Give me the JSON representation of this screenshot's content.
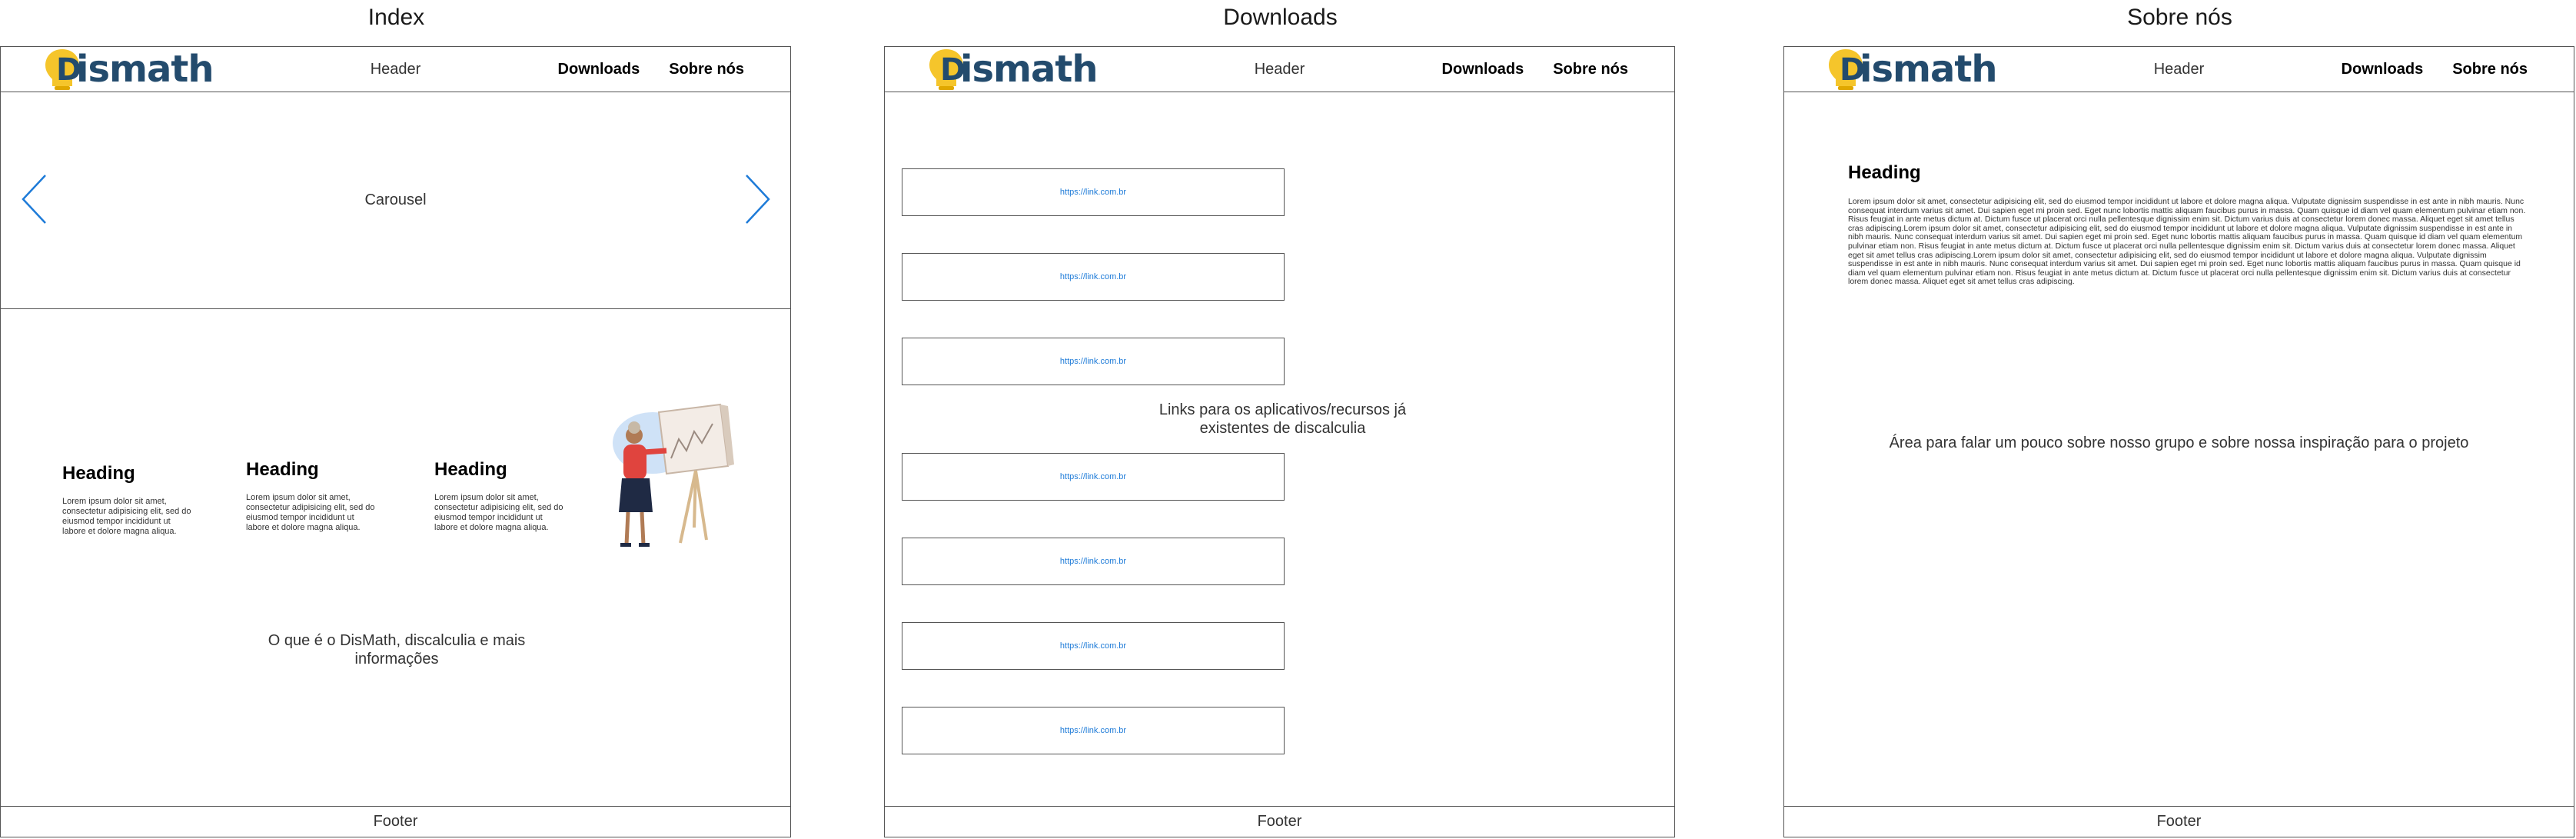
{
  "pages": {
    "index": {
      "title": "Index",
      "carousel_label": "Carousel",
      "features": [
        {
          "heading": "Heading",
          "text": "Lorem ipsum dolor sit amet, consectetur adipisicing elit, sed do eiusmod tempor incididunt ut labore et dolore magna aliqua."
        },
        {
          "heading": "Heading",
          "text": "Lorem ipsum dolor sit amet, consectetur adipisicing elit, sed do eiusmod tempor incididunt ut labore et dolore magna aliqua."
        },
        {
          "heading": "Heading",
          "text": "Lorem ipsum dolor sit amet, consectetur adipisicing elit, sed do eiusmod tempor incididunt ut labore et dolore magna aliqua."
        }
      ],
      "note": "O que é o DisMath, discalculia e mais informações"
    },
    "downloads": {
      "title": "Downloads",
      "links": [
        "https://link.com.br",
        "https://link.com.br",
        "https://link.com.br",
        "https://link.com.br",
        "https://link.com.br",
        "https://link.com.br",
        "https://link.com.br"
      ],
      "note": "Links para os aplicativos/recursos já existentes de discalculia"
    },
    "sobre": {
      "title": "Sobre nós",
      "heading": "Heading",
      "text": "Lorem ipsum dolor sit amet, consectetur adipisicing elit, sed do eiusmod tempor incididunt ut labore et dolore magna aliqua. Vulputate dignissim suspendisse in est ante in nibh mauris. Nunc consequat interdum varius sit amet. Dui sapien eget mi proin sed. Eget nunc lobortis mattis aliquam faucibus purus in massa. Quam quisque id diam vel quam elementum pulvinar etiam non. Risus feugiat in ante metus dictum at. Dictum fusce ut placerat orci nulla pellentesque dignissim enim sit. Dictum varius duis at consectetur lorem donec massa. Aliquet eget sit amet tellus cras adipiscing.Lorem ipsum dolor sit amet, consectetur adipisicing elit, sed do eiusmod tempor incididunt ut labore et dolore magna aliqua. Vulputate dignissim suspendisse in est ante in nibh mauris. Nunc consequat interdum varius sit amet. Dui sapien eget mi proin sed. Eget nunc lobortis mattis aliquam faucibus purus in massa. Quam quisque id diam vel quam elementum pulvinar etiam non. Risus feugiat in ante metus dictum at. Dictum fusce ut placerat orci nulla pellentesque dignissim enim sit. Dictum varius duis at consectetur lorem donec massa. Aliquet eget sit amet tellus cras adipiscing.Lorem ipsum dolor sit amet, consectetur adipisicing elit, sed do eiusmod tempor incididunt ut labore et dolore magna aliqua. Vulputate dignissim suspendisse in est ante in nibh mauris. Nunc consequat interdum varius sit amet. Dui sapien eget mi proin sed. Eget nunc lobortis mattis aliquam faucibus purus in massa. Quam quisque id diam vel quam elementum pulvinar etiam non. Risus feugiat in ante metus dictum at. Dictum fusce ut placerat orci nulla pellentesque dignissim enim sit. Dictum varius duis at consectetur lorem donec massa. Aliquet eget sit amet tellus cras adipiscing.",
      "note": "Área para falar um pouco sobre nosso grupo e sobre nossa inspiração para o projeto"
    }
  },
  "common": {
    "logo_text": "ismath",
    "logo_letter": "D",
    "header_label": "Header",
    "nav": [
      "Downloads",
      "Sobre nós"
    ],
    "footer_label": "Footer"
  },
  "colors": {
    "logo_yellow": "#f5c52b",
    "logo_blue": "#234b6d",
    "arrow_blue": "#1e7bd8",
    "link_blue": "#1e7bd8"
  }
}
